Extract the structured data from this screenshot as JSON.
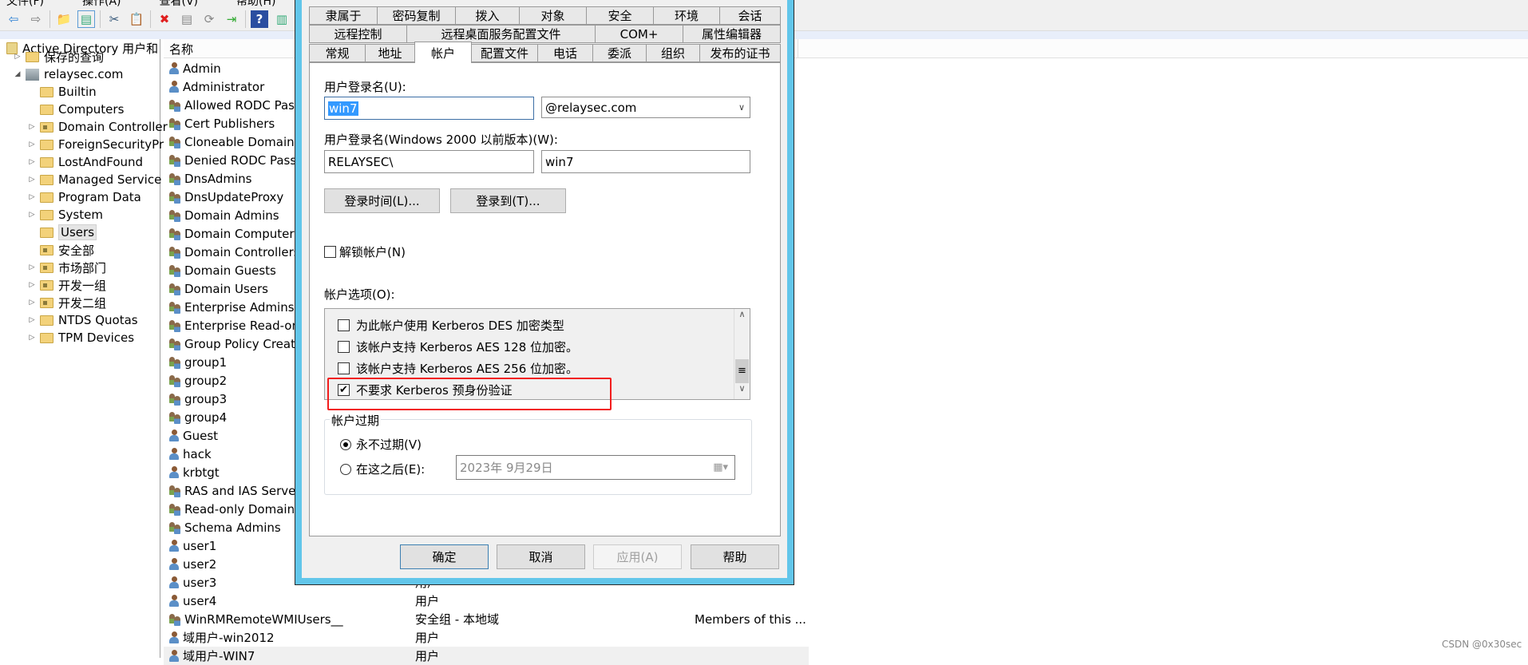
{
  "menu": [
    "文件(F)",
    "操作(A)",
    "查看(V)",
    "帮助(H)"
  ],
  "toolbar": [
    "back-icon",
    "forward-icon",
    "up-folder-icon",
    "show-hide-tree-icon",
    "cut-icon",
    "paste-icon",
    "delete-icon",
    "properties-icon",
    "refresh-icon",
    "export-icon",
    "help-icon",
    "action-pane-icon",
    "new-user-icon",
    "new-group-icon"
  ],
  "tree": {
    "root": "Active Directory 用户和",
    "items": [
      {
        "label": "保存的查询",
        "level": 1,
        "expander": "▷",
        "kind": "folder"
      },
      {
        "label": "relaysec.com",
        "level": 1,
        "expander": "◢",
        "kind": "domain"
      },
      {
        "label": "Builtin",
        "level": 2,
        "expander": "",
        "kind": "folder"
      },
      {
        "label": "Computers",
        "level": 2,
        "expander": "",
        "kind": "folder"
      },
      {
        "label": "Domain Controller",
        "level": 2,
        "expander": "▷",
        "kind": "ou"
      },
      {
        "label": "ForeignSecurityPr",
        "level": 2,
        "expander": "▷",
        "kind": "folder"
      },
      {
        "label": "LostAndFound",
        "level": 2,
        "expander": "▷",
        "kind": "folder"
      },
      {
        "label": "Managed Service",
        "level": 2,
        "expander": "▷",
        "kind": "folder"
      },
      {
        "label": "Program Data",
        "level": 2,
        "expander": "▷",
        "kind": "folder"
      },
      {
        "label": "System",
        "level": 2,
        "expander": "▷",
        "kind": "folder"
      },
      {
        "label": "Users",
        "level": 2,
        "expander": "",
        "kind": "folder",
        "selected": true
      },
      {
        "label": "安全部",
        "level": 2,
        "expander": "",
        "kind": "ou"
      },
      {
        "label": "市场部门",
        "level": 2,
        "expander": "▷",
        "kind": "ou"
      },
      {
        "label": "开发一组",
        "level": 2,
        "expander": "▷",
        "kind": "ou"
      },
      {
        "label": "开发二组",
        "level": 2,
        "expander": "▷",
        "kind": "ou"
      },
      {
        "label": "NTDS Quotas",
        "level": 2,
        "expander": "▷",
        "kind": "folder"
      },
      {
        "label": "TPM Devices",
        "level": 2,
        "expander": "▷",
        "kind": "folder"
      }
    ]
  },
  "list": {
    "header": "名称",
    "rows": [
      {
        "name": "Admin",
        "icon": "user"
      },
      {
        "name": "Administrator",
        "icon": "user"
      },
      {
        "name": "Allowed RODC Pass",
        "icon": "group"
      },
      {
        "name": "Cert Publishers",
        "icon": "group"
      },
      {
        "name": "Cloneable Domain C",
        "icon": "group"
      },
      {
        "name": "Denied RODC Passw",
        "icon": "group"
      },
      {
        "name": "DnsAdmins",
        "icon": "group"
      },
      {
        "name": "DnsUpdateProxy",
        "icon": "group"
      },
      {
        "name": "Domain Admins",
        "icon": "group"
      },
      {
        "name": "Domain Computers",
        "icon": "group"
      },
      {
        "name": "Domain Controllers",
        "icon": "group"
      },
      {
        "name": "Domain Guests",
        "icon": "group"
      },
      {
        "name": "Domain Users",
        "icon": "group"
      },
      {
        "name": "Enterprise Admins",
        "icon": "group"
      },
      {
        "name": "Enterprise Read-on",
        "icon": "group"
      },
      {
        "name": "Group Policy Creato",
        "icon": "group"
      },
      {
        "name": "group1",
        "icon": "group"
      },
      {
        "name": "group2",
        "icon": "group"
      },
      {
        "name": "group3",
        "icon": "group"
      },
      {
        "name": "group4",
        "icon": "group"
      },
      {
        "name": "Guest",
        "icon": "user"
      },
      {
        "name": "hack",
        "icon": "user"
      },
      {
        "name": "krbtgt",
        "icon": "user"
      },
      {
        "name": "RAS and IAS Server",
        "icon": "group"
      },
      {
        "name": "Read-only Domain C",
        "icon": "group"
      },
      {
        "name": "Schema Admins",
        "icon": "group"
      },
      {
        "name": "user1",
        "icon": "user"
      },
      {
        "name": "user2",
        "icon": "user"
      },
      {
        "name": "user3",
        "icon": "user",
        "type": "用户"
      },
      {
        "name": "user4",
        "icon": "user",
        "type": "用户"
      },
      {
        "name": "WinRMRemoteWMIUsers__",
        "icon": "group",
        "type": "安全组 - 本地域",
        "desc": "Members of this ..."
      },
      {
        "name": "域用户-win2012",
        "icon": "user",
        "type": "用户"
      },
      {
        "name": "域用户-WIN7",
        "icon": "user",
        "type": "用户",
        "selected": true
      }
    ]
  },
  "dialog": {
    "tabs_row1": [
      "隶属于",
      "密码复制",
      "拨入",
      "对象",
      "安全",
      "环境",
      "会话"
    ],
    "tabs_row2": [
      "远程控制",
      "远程桌面服务配置文件",
      "COM+",
      "属性编辑器"
    ],
    "tabs_row3": [
      "常规",
      "地址",
      "帐户",
      "配置文件",
      "电话",
      "委派",
      "组织",
      "发布的证书"
    ],
    "active_tab": "帐户",
    "logon_label": "用户登录名(U):",
    "logon_value": "win7",
    "domain_value": "@relaysec.com",
    "pre2000_label": "用户登录名(Windows 2000 以前版本)(W):",
    "pre2000_domain": "RELAYSEC\\",
    "pre2000_user": "win7",
    "logon_hours_btn": "登录时间(L)...",
    "logon_to_btn": "登录到(T)...",
    "unlock_label": "解锁帐户(N)",
    "unlock_checked": false,
    "options_label": "帐户选项(O):",
    "options": [
      {
        "label": "为此帐户使用 Kerberos DES 加密类型",
        "checked": false
      },
      {
        "label": "该帐户支持 Kerberos AES 128 位加密。",
        "checked": false
      },
      {
        "label": "该帐户支持 Kerberos AES 256 位加密。",
        "checked": false
      },
      {
        "label": "不要求 Kerberos 预身份验证",
        "checked": true
      }
    ],
    "expiry_title": "帐户过期",
    "never_label": "永不过期(V)",
    "end_label": "在这之后(E):",
    "expiry_selected": "never",
    "date_value": "2023年  9月29日",
    "ok": "确定",
    "cancel": "取消",
    "apply": "应用(A)",
    "help": "帮助"
  },
  "colors": {
    "dialog_border": "#62c6ea",
    "highlight": "#f21d1d",
    "selection": "#3399ff"
  },
  "watermark": "CSDN @0x30sec"
}
